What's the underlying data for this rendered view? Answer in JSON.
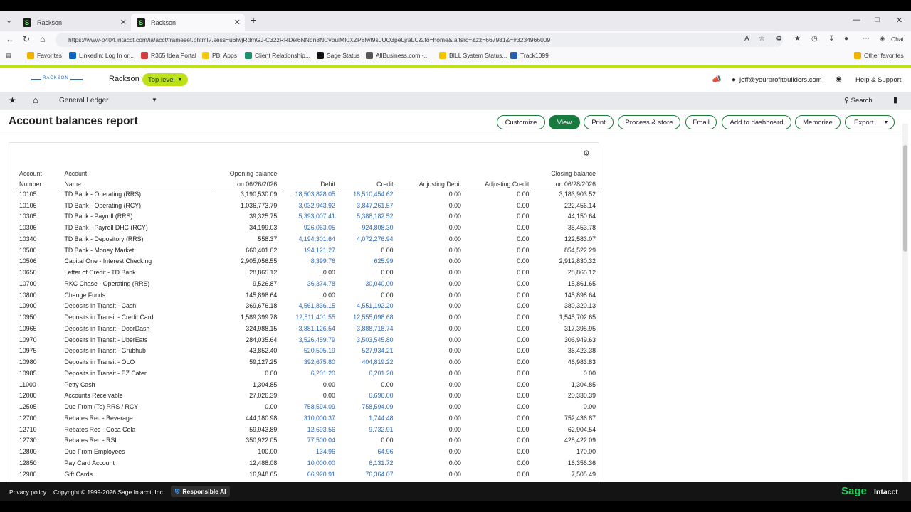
{
  "browser": {
    "tabs": [
      {
        "label": "Rackson"
      },
      {
        "label": "Rackson"
      }
    ],
    "url": "https://www-p404.intacct.com/ia/acct/frameset.phtml?.sess=u6lwjRdmGJ-C32zRRDel6NNdn8NCvbuiMI0XZP8lwt9s0UQ3pe0jraLC&.fo=home&.altsrc=&zz=667981&=#3234966009",
    "chat_label": "Chat",
    "favorites": [
      {
        "label": "Favorites",
        "color": "#f0b400"
      },
      {
        "label": "LinkedIn: Log In or...",
        "color": "#0a66c2"
      },
      {
        "label": "R365 Idea Portal",
        "color": "#d04040"
      },
      {
        "label": "PBI Apps",
        "color": "#f2c811"
      },
      {
        "label": "Client Relationship...",
        "color": "#1f8f6f"
      },
      {
        "label": "Sage Status",
        "color": "#111111"
      },
      {
        "label": "AllBusiness.com -...",
        "color": "#555555"
      },
      {
        "label": "BILL System Status...",
        "color": "#f5c400"
      },
      {
        "label": "Track1099",
        "color": "#2a5fb0"
      }
    ],
    "other_favorites": "Other favorites"
  },
  "app": {
    "logo_text": "RACKSON",
    "company": "Rackson",
    "entity_selector": "Top level",
    "user_email": "jeff@yourprofitbuilders.com",
    "help": "Help & Support",
    "module": "General Ledger",
    "search": "Search"
  },
  "page": {
    "title": "Account balances report",
    "buttons": [
      "Customize",
      "View",
      "Print",
      "Process & store",
      "Email",
      "Add to dashboard",
      "Memorize",
      "Export"
    ]
  },
  "report": {
    "headers": {
      "acct_top": "Account",
      "acct_bottom": "Number",
      "name_top": "Account",
      "name_bottom": "Name",
      "open_top": "Opening balance",
      "open_bottom": "on 06/26/2026",
      "debit": "Debit",
      "credit": "Credit",
      "adj_debit": "Adjusting Debit",
      "adj_credit": "Adjusting Credit",
      "close_top": "Closing balance",
      "close_bottom": "on 06/28/2026"
    },
    "rows": [
      [
        "10105",
        "TD Bank - Operating (RRS)",
        "3,190,530.09",
        "18,503,828.05",
        "18,510,454.62",
        "0.00",
        "0.00",
        "3,183,903.52"
      ],
      [
        "10106",
        "TD Bank - Operating (RCY)",
        "1,036,773.79",
        "3,032,943.92",
        "3,847,261.57",
        "0.00",
        "0.00",
        "222,456.14"
      ],
      [
        "10305",
        "TD Bank - Payroll (RRS)",
        "39,325.75",
        "5,393,007.41",
        "5,388,182.52",
        "0.00",
        "0.00",
        "44,150.64"
      ],
      [
        "10306",
        "TD Bank - Payroll DHC (RCY)",
        "34,199.03",
        "926,063.05",
        "924,808.30",
        "0.00",
        "0.00",
        "35,453.78"
      ],
      [
        "10340",
        "TD Bank - Depository (RRS)",
        "558.37",
        "4,194,301.64",
        "4,072,276.94",
        "0.00",
        "0.00",
        "122,583.07"
      ],
      [
        "10500",
        "TD Bank - Money Market",
        "660,401.02",
        "194,121.27",
        "0.00",
        "0.00",
        "0.00",
        "854,522.29"
      ],
      [
        "10506",
        "Capital One - Interest Checking",
        "2,905,056.55",
        "8,399.76",
        "625.99",
        "0.00",
        "0.00",
        "2,912,830.32"
      ],
      [
        "10650",
        "Letter of Credit - TD Bank",
        "28,865.12",
        "0.00",
        "0.00",
        "0.00",
        "0.00",
        "28,865.12"
      ],
      [
        "10700",
        "RKC Chase - Operating (RRS)",
        "9,526.87",
        "36,374.78",
        "30,040.00",
        "0.00",
        "0.00",
        "15,861.65"
      ],
      [
        "10800",
        "Change Funds",
        "145,898.64",
        "0.00",
        "0.00",
        "0.00",
        "0.00",
        "145,898.64"
      ],
      [
        "10900",
        "Deposits in Transit - Cash",
        "369,676.18",
        "4,561,836.15",
        "4,551,192.20",
        "0.00",
        "0.00",
        "380,320.13"
      ],
      [
        "10950",
        "Deposits in Transit - Credit Card",
        "1,589,399.78",
        "12,511,401.55",
        "12,555,098.68",
        "0.00",
        "0.00",
        "1,545,702.65"
      ],
      [
        "10965",
        "Deposits in Transit - DoorDash",
        "324,988.15",
        "3,881,126.54",
        "3,888,718.74",
        "0.00",
        "0.00",
        "317,395.95"
      ],
      [
        "10970",
        "Deposits in Transit - UberEats",
        "284,035.64",
        "3,526,459.79",
        "3,503,545.80",
        "0.00",
        "0.00",
        "306,949.63"
      ],
      [
        "10975",
        "Deposits in Transit - Grubhub",
        "43,852.40",
        "520,505.19",
        "527,934.21",
        "0.00",
        "0.00",
        "36,423.38"
      ],
      [
        "10980",
        "Deposits in Transit - OLO",
        "59,127.25",
        "392,675.80",
        "404,819.22",
        "0.00",
        "0.00",
        "46,983.83"
      ],
      [
        "10985",
        "Deposits in Transit - EZ Cater",
        "0.00",
        "6,201.20",
        "6,201.20",
        "0.00",
        "0.00",
        "0.00"
      ],
      [
        "11000",
        "Petty Cash",
        "1,304.85",
        "0.00",
        "0.00",
        "0.00",
        "0.00",
        "1,304.85"
      ],
      [
        "12000",
        "Accounts Receivable",
        "27,026.39",
        "0.00",
        "6,696.00",
        "0.00",
        "0.00",
        "20,330.39"
      ],
      [
        "12505",
        "Due From (To) RRS / RCY",
        "0.00",
        "758,594.09",
        "758,594.09",
        "0.00",
        "0.00",
        "0.00"
      ],
      [
        "12700",
        "Rebates Rec - Beverage",
        "444,180.98",
        "310,000.37",
        "1,744.48",
        "0.00",
        "0.00",
        "752,436.87"
      ],
      [
        "12710",
        "Rebates Rec - Coca Cola",
        "59,943.89",
        "12,693.56",
        "9,732.91",
        "0.00",
        "0.00",
        "62,904.54"
      ],
      [
        "12730",
        "Rebates Rec - RSI",
        "350,922.05",
        "77,500.04",
        "0.00",
        "0.00",
        "0.00",
        "428,422.09"
      ],
      [
        "12800",
        "Due From Employees",
        "100.00",
        "134.96",
        "64.96",
        "0.00",
        "0.00",
        "170.00"
      ],
      [
        "12850",
        "Pay Card Account",
        "12,488.08",
        "10,000.00",
        "6,131.72",
        "0.00",
        "0.00",
        "16,356.36"
      ],
      [
        "12900",
        "Gift Cards",
        "16,948.65",
        "66,920.91",
        "76,364.07",
        "0.00",
        "0.00",
        "7,505.49"
      ]
    ]
  },
  "footer": {
    "privacy": "Privacy policy",
    "copyright": "Copyright © 1999-2026 Sage Intacct, Inc.",
    "responsible_ai": "Responsible AI",
    "sage": "Sage",
    "intacct": "Intacct"
  },
  "colors": {
    "accent_green": "#197a3f",
    "lime": "#bde21a",
    "link_blue": "#2d6bbf"
  }
}
